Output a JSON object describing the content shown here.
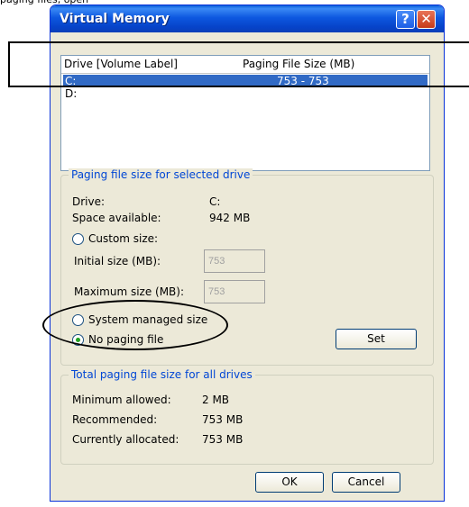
{
  "window": {
    "title": "Virtual Memory",
    "help_glyph": "?",
    "close_glyph": "✕"
  },
  "top_caption": "paging files, open",
  "drive_list": {
    "col_drive": "Drive  [Volume Label]",
    "col_size": "Paging File Size (MB)",
    "rows": [
      {
        "drive": "C:",
        "size": "753 - 753",
        "selected": true
      },
      {
        "drive": "D:",
        "size": "",
        "selected": false
      }
    ]
  },
  "selected_drive_group": {
    "label": "Paging file size for selected drive",
    "drive_label": "Drive:",
    "drive_value": "C:",
    "space_label": "Space available:",
    "space_value": "942 MB",
    "custom_size_label": "Custom size:",
    "initial_size_label": "Initial size (MB):",
    "initial_size_value": "753",
    "max_size_label": "Maximum size (MB):",
    "max_size_value": "753",
    "system_managed_label": "System managed size",
    "no_paging_label": "No paging file",
    "set_button": "Set",
    "selected_option": "no-paging-file"
  },
  "totals_group": {
    "label": "Total paging file size for all drives",
    "min_label": "Minimum allowed:",
    "min_value": "2 MB",
    "rec_label": "Recommended:",
    "rec_value": "753 MB",
    "alloc_label": "Currently allocated:",
    "alloc_value": "753 MB"
  },
  "buttons": {
    "ok": "OK",
    "cancel": "Cancel"
  },
  "colors": {
    "titlebar": "#0a5fd8",
    "selection": "#316ac5",
    "group_label": "#0046d5",
    "dialog_bg": "#ece9d8"
  }
}
